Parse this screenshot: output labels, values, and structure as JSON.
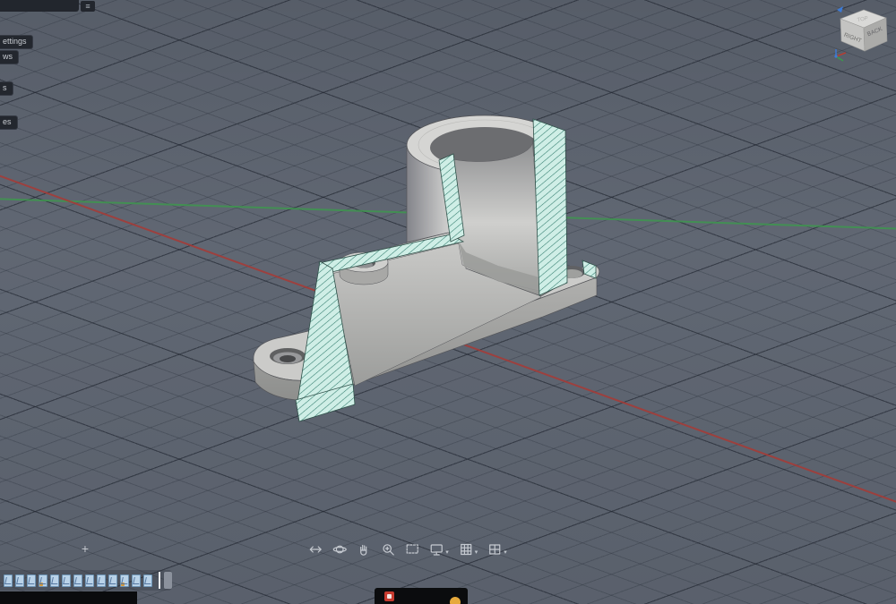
{
  "canvas": {
    "background": "#5d6470",
    "grid_minor_color": "#282d39",
    "grid_major_color": "#1c212b"
  },
  "axes": {
    "x_axis_color": "#a83a35",
    "z_axis_color": "#3c9a4c"
  },
  "topbar": {},
  "icons": {
    "hamburger": "≡",
    "plus": "+",
    "caret": "▾"
  },
  "browser_flyout": {
    "items": [
      "ettings",
      "ws",
      "s",
      "es"
    ]
  },
  "viewcube": {
    "top_label": "TOP",
    "left_label": "RIGHT",
    "right_label": "BACK",
    "triad_colors": {
      "x": "#c0392b",
      "y": "#3c9a4c",
      "z": "#3d7bd6"
    }
  },
  "model": {
    "description": "section analysis of flanged cylindrical bracket",
    "section_hatch_fill": "#cfeee6",
    "section_hatch_line": "#2f7a6b",
    "body_light": "#d6d6d4",
    "body_mid": "#b9b9b7",
    "body_dark": "#8e8f8d"
  },
  "nav_toolbar": {
    "buttons": [
      {
        "name": "pan-arrows",
        "caret": false
      },
      {
        "name": "free-orbit",
        "caret": false
      },
      {
        "name": "pan-hand",
        "caret": false
      },
      {
        "name": "zoom",
        "caret": false
      },
      {
        "name": "zoom-window",
        "caret": false
      },
      {
        "name": "display-settings",
        "caret": true
      },
      {
        "name": "grid-and-snaps",
        "caret": true
      },
      {
        "name": "viewports",
        "caret": true
      }
    ]
  },
  "timeline": {
    "features": [
      {
        "mark": null
      },
      {
        "mark": null
      },
      {
        "mark": null
      },
      {
        "mark": "#d89a3a"
      },
      {
        "mark": null
      },
      {
        "mark": null
      },
      {
        "mark": null
      },
      {
        "mark": null
      },
      {
        "mark": null
      },
      {
        "mark": null
      },
      {
        "mark": "#d89a3a"
      },
      {
        "mark": null
      },
      {
        "mark": null
      }
    ]
  },
  "taskbar": {
    "red_icon_color": "#c63b30",
    "yellow_icon_color": "#e6a93c"
  }
}
